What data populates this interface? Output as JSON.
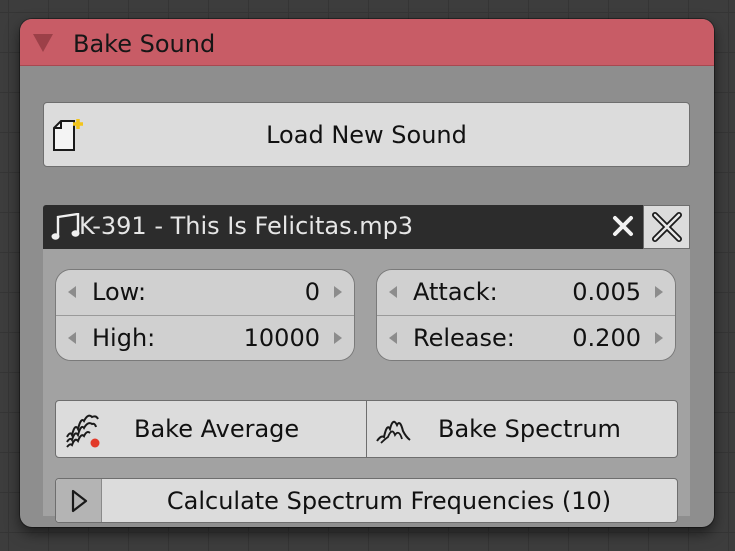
{
  "node": {
    "title": "Bake Sound",
    "header_color": "#c85c66"
  },
  "load_button": {
    "label": "Load New Sound",
    "icon": "new-file-icon"
  },
  "sound": {
    "icon": "music-note-icon",
    "name": "K-391 - This Is Felicitas.mp3",
    "clear_icon": "close-icon",
    "unlink_icon": "unlink-x-icon"
  },
  "frequency": {
    "low": {
      "label": "Low:",
      "value": "0"
    },
    "high": {
      "label": "High:",
      "value": "10000"
    }
  },
  "envelope": {
    "attack": {
      "label": "Attack:",
      "value": "0.005"
    },
    "release": {
      "label": "Release:",
      "value": "0.200"
    }
  },
  "bake": {
    "average": {
      "label": "Bake Average",
      "icon": "waveform-bake-icon"
    },
    "spectrum": {
      "label": "Bake Spectrum",
      "icon": "spectrum-icon"
    }
  },
  "calculate": {
    "label": "Calculate Spectrum Frequencies (10)",
    "toggle_icon": "play-triangle-icon"
  }
}
